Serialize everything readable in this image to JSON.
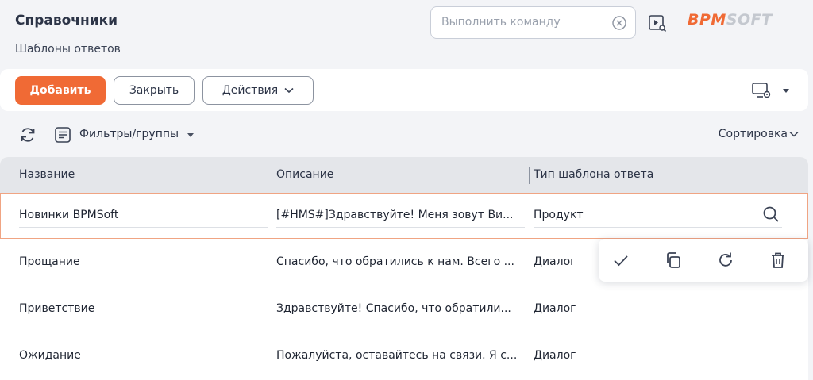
{
  "header": {
    "title": "Справочники",
    "subtitle": "Шаблоны ответов",
    "command_placeholder": "Выполнить команду",
    "logo_part1": "BPM",
    "logo_part2": "SOFT"
  },
  "toolbar": {
    "add_label": "Добавить",
    "close_label": "Закрыть",
    "actions_label": "Действия"
  },
  "filters": {
    "filter_label": "Фильтры/группы",
    "sort_label": "Сортировка"
  },
  "grid": {
    "columns": [
      "Название",
      "Описание",
      "Тип шаблона ответа"
    ],
    "rows": [
      {
        "name": "Новинки BPMSoft",
        "description": "[#HMS#]Здравствуйте! Меня зовут Ви...",
        "type": "Продукт"
      },
      {
        "name": "Прощание",
        "description": "Спасибо, что обратились к нам. Всего ...",
        "type": "Диалог"
      },
      {
        "name": "Приветствие",
        "description": "Здравствуйте! Спасибо, что обратили...",
        "type": "Диалог"
      },
      {
        "name": "Ожидание",
        "description": "Пожалуйста, оставайтесь на связи. Я с...",
        "type": "Диалог"
      }
    ]
  },
  "icons": {
    "clear": "close-circle-icon",
    "video": "video-help-icon",
    "refresh": "refresh-icon",
    "filter": "filter-list-icon",
    "lookup": "search-icon",
    "save": "check-icon",
    "copy": "copy-icon",
    "cancel": "undo-icon",
    "delete": "trash-icon",
    "view": "view-settings-icon"
  },
  "colors": {
    "accent": "#f06a35",
    "muted": "#c4c8cf"
  }
}
